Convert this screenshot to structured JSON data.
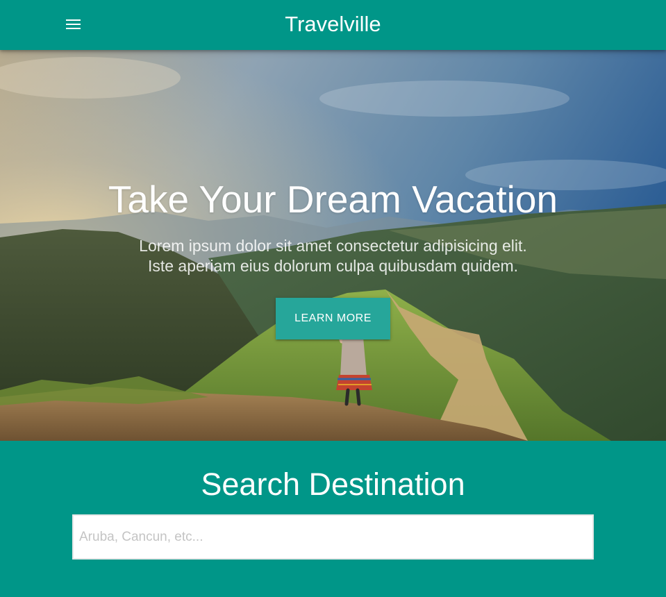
{
  "navbar": {
    "brand": "Travelville",
    "menu_icon": "hamburger-menu-icon",
    "background_color": "#009688"
  },
  "hero": {
    "title": "Take Your Dream Vacation",
    "lead_line_1": "Lorem ipsum dolor sit amet consectetur adipisicing elit.",
    "lead_line_2": "Iste aperiam eius dolorum culpa quibusdam quidem.",
    "button_label": "LEARN MORE",
    "button_color": "#26a69a",
    "image_subject": "hiker-on-mountain-ridge"
  },
  "search": {
    "title": "Search Destination",
    "placeholder": "Aruba, Cancun, etc...",
    "value": ""
  }
}
